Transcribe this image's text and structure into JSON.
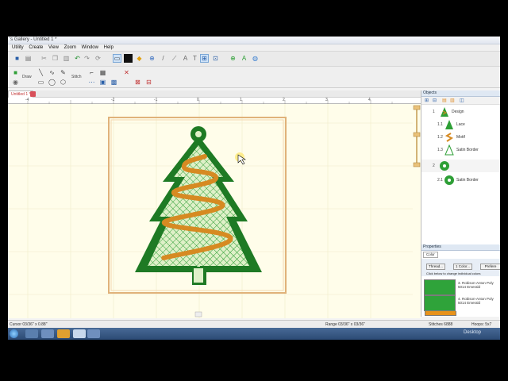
{
  "window": {
    "title": "'s Gallery - Untitled 1 *"
  },
  "menu": [
    "Utility",
    "Create",
    "View",
    "Zoom",
    "Window",
    "Help"
  ],
  "toolbar2": {
    "draw_label": "Draw",
    "stitch_label": "Stitch"
  },
  "document_tab": {
    "label": "Untitled 1 *"
  },
  "ruler_numbers": [
    "-4",
    "-2",
    "-1",
    "0",
    "1",
    "2",
    "3",
    "4"
  ],
  "objects_panel": {
    "header": "Objects",
    "items": [
      {
        "index": "1",
        "label": "Design",
        "icon": "tree-design-icon"
      },
      {
        "index": "1.1",
        "label": "Lace",
        "icon": "tree-lace-icon"
      },
      {
        "index": "1.2",
        "label": "Motif",
        "icon": "motif-icon"
      },
      {
        "index": "1.3",
        "label": "Satin Border",
        "icon": "tree-outline-icon"
      },
      {
        "index": "2",
        "label": "",
        "icon": "ring-icon"
      },
      {
        "index": "2.1",
        "label": "Satin Border",
        "icon": "ring-icon"
      }
    ]
  },
  "properties_panel": {
    "header": "Properties",
    "tab": "Color",
    "buttons": [
      "Thread...",
      "1 Color...",
      "Prefere"
    ],
    "hint": "Click below to change individual colors",
    "colors": [
      {
        "text": "1. Robison-Anton Poly 5014 Emerald",
        "hex": "#2fa33a"
      },
      {
        "text": "2. Robison-Anton Poly 5552 Sun Gold",
        "hex": "#e8921a"
      },
      {
        "text": "3. Robison-Anton Poly 5014 Emerald",
        "hex": "#2fa33a"
      },
      {
        "text": "4. Robison-Anton Poly 5014 Emerald",
        "hex": "#2fa33a"
      }
    ]
  },
  "status": {
    "cursor": "Cursor 03/36\" x 0.88\"",
    "range": "Range 03/36\" x 03/36\"",
    "stitches": "Stitches 6888",
    "extra": "Hoops: 5x7"
  },
  "taskbar": {
    "clock": "Desktop"
  },
  "colors": {
    "accent_green": "#2e9f36",
    "dark_green": "#1e7a24",
    "gold": "#d68a22",
    "canvas_bg": "#fffdea",
    "hoop_border": "#e0b27a"
  }
}
